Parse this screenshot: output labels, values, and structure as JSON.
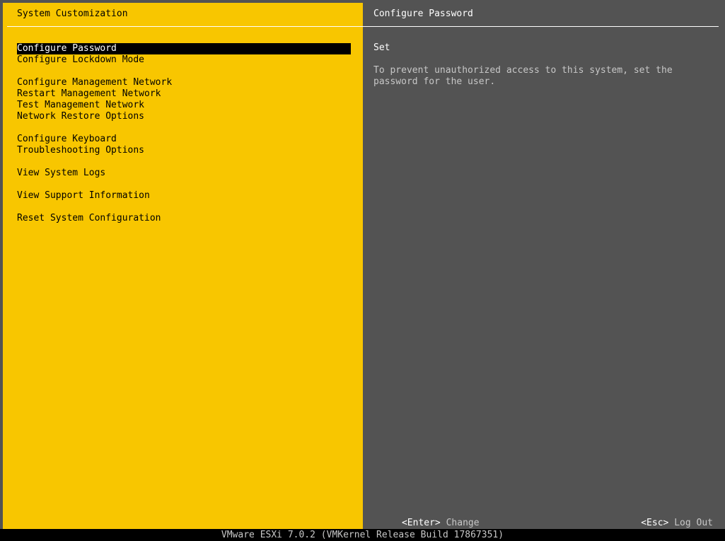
{
  "left_panel": {
    "title": "System Customization",
    "menu": [
      {
        "label": "Configure Password",
        "selected": true,
        "gap_before": false
      },
      {
        "label": "Configure Lockdown Mode",
        "selected": false,
        "gap_before": false
      },
      {
        "label": "Configure Management Network",
        "selected": false,
        "gap_before": true
      },
      {
        "label": "Restart Management Network",
        "selected": false,
        "gap_before": false
      },
      {
        "label": "Test Management Network",
        "selected": false,
        "gap_before": false
      },
      {
        "label": "Network Restore Options",
        "selected": false,
        "gap_before": false
      },
      {
        "label": "Configure Keyboard",
        "selected": false,
        "gap_before": true
      },
      {
        "label": "Troubleshooting Options",
        "selected": false,
        "gap_before": false
      },
      {
        "label": "View System Logs",
        "selected": false,
        "gap_before": true
      },
      {
        "label": "View Support Information",
        "selected": false,
        "gap_before": true
      },
      {
        "label": "Reset System Configuration",
        "selected": false,
        "gap_before": true
      }
    ]
  },
  "right_panel": {
    "title": "Configure Password",
    "value": "Set",
    "description": "To prevent unauthorized access to this system, set the\npassword for the user."
  },
  "footer": {
    "enter_key": "<Enter>",
    "enter_action": "Change",
    "esc_key": "<Esc>",
    "esc_action": "Log Out"
  },
  "status_bar": {
    "text": "VMware ESXi 7.0.2 (VMKernel Release Build 17867351)"
  },
  "colors": {
    "left_background": "#f8c600",
    "right_background": "#535353",
    "selection_background": "#000000",
    "description_text": "#c7c7c7"
  }
}
